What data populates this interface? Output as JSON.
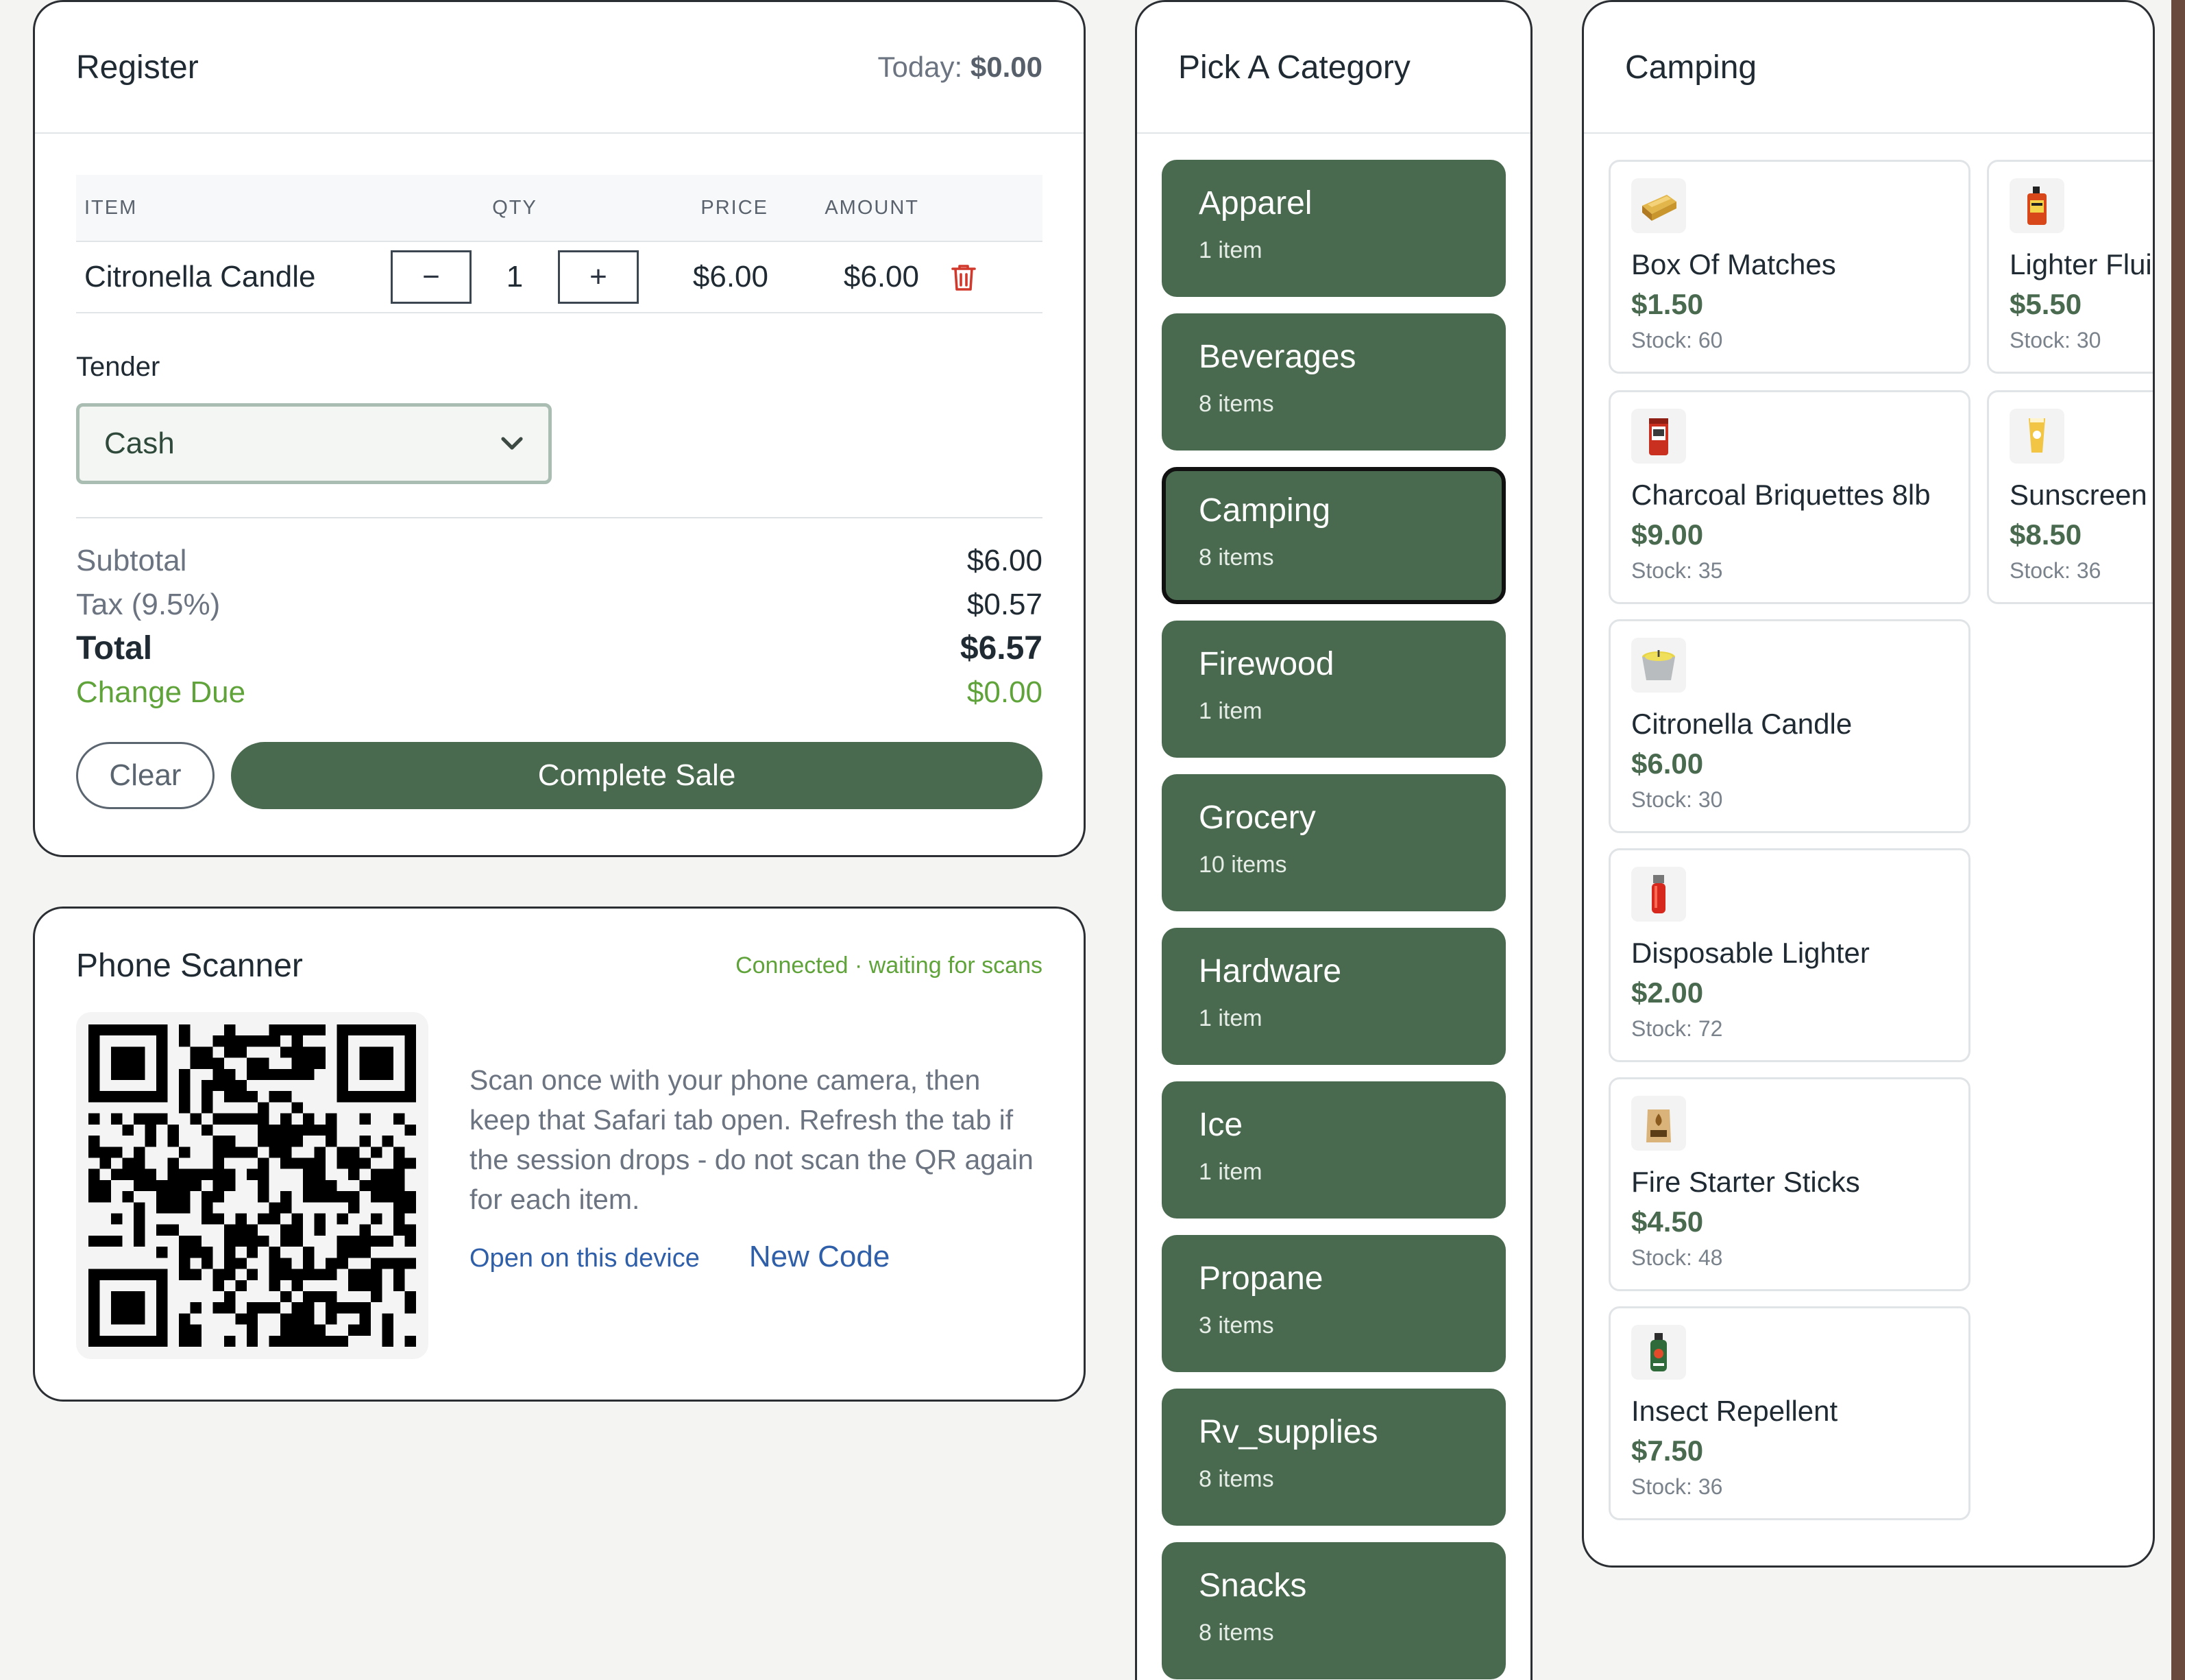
{
  "register": {
    "title": "Register",
    "today_label": "Today:",
    "today_value": "$0.00",
    "columns": {
      "item": "ITEM",
      "qty": "QTY",
      "price": "PRICE",
      "amount": "AMOUNT"
    },
    "line": {
      "item": "Citronella Candle",
      "minus": "−",
      "qty": "1",
      "plus": "+",
      "price": "$6.00",
      "amount": "$6.00"
    },
    "tender_label": "Tender",
    "tender_value": "Cash",
    "subtotal_label": "Subtotal",
    "subtotal": "$6.00",
    "tax_label": "Tax (9.5%)",
    "tax": "$0.57",
    "total_label": "Total",
    "total": "$6.57",
    "change_label": "Change Due",
    "change": "$0.00",
    "clear_label": "Clear",
    "complete_label": "Complete Sale"
  },
  "scanner": {
    "title": "Phone Scanner",
    "status": "Connected · waiting for scans",
    "description": "Scan once with your phone camera, then keep that Safari tab open. Refresh the tab if the session drops - do not scan the QR again for each item.",
    "open_link": "Open on this device",
    "new_code": "New Code"
  },
  "categories": {
    "title": "Pick A Category",
    "items": [
      {
        "name": "Apparel",
        "count": "1 item"
      },
      {
        "name": "Beverages",
        "count": "8 items"
      },
      {
        "name": "Camping",
        "count": "8 items"
      },
      {
        "name": "Firewood",
        "count": "1 item"
      },
      {
        "name": "Grocery",
        "count": "10 items"
      },
      {
        "name": "Hardware",
        "count": "1 item"
      },
      {
        "name": "Ice",
        "count": "1 item"
      },
      {
        "name": "Propane",
        "count": "3 items"
      },
      {
        "name": "Rv_supplies",
        "count": "8 items"
      },
      {
        "name": "Snacks",
        "count": "8 items"
      }
    ],
    "selected": "Camping"
  },
  "products": {
    "title": "Camping",
    "items": [
      {
        "name": "Box Of Matches",
        "price": "$1.50",
        "stock": "Stock: 60",
        "icon": "matchbox-icon"
      },
      {
        "name": "Lighter Flui",
        "price": "$5.50",
        "stock": "Stock: 30",
        "icon": "lighter-fluid-icon"
      },
      {
        "name": "Charcoal Briquettes 8lb",
        "price": "$9.00",
        "stock": "Stock: 35",
        "icon": "charcoal-bag-icon"
      },
      {
        "name": "Sunscreen S",
        "price": "$8.50",
        "stock": "Stock: 36",
        "icon": "sunscreen-icon"
      },
      {
        "name": "Citronella Candle",
        "price": "$6.00",
        "stock": "Stock: 30",
        "icon": "candle-bucket-icon"
      },
      {
        "name": "Disposable Lighter",
        "price": "$2.00",
        "stock": "Stock: 72",
        "icon": "lighter-icon"
      },
      {
        "name": "Fire Starter Sticks",
        "price": "$4.50",
        "stock": "Stock: 48",
        "icon": "fire-starter-icon"
      },
      {
        "name": "Insect Repellent",
        "price": "$7.50",
        "stock": "Stock: 36",
        "icon": "repellent-can-icon"
      }
    ]
  },
  "colors": {
    "accent": "#4a6a50",
    "success": "#5fa33a",
    "link": "#2e5fa8",
    "delete": "#d0392b"
  }
}
